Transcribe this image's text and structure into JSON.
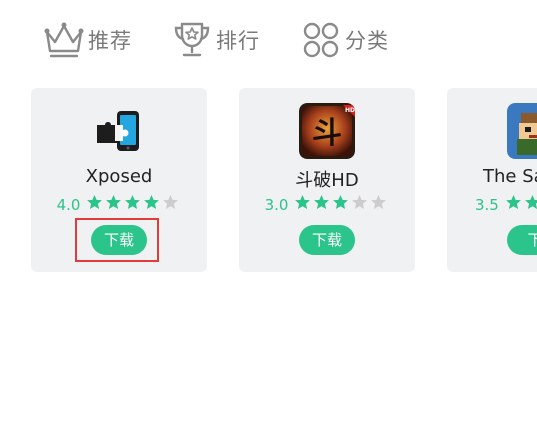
{
  "nav": {
    "items": [
      {
        "label": "推荐",
        "icon": "crown-icon"
      },
      {
        "label": "排行",
        "icon": "trophy-icon"
      },
      {
        "label": "分类",
        "icon": "category-grid-icon"
      }
    ],
    "color": "#7a7a7a"
  },
  "apps": [
    {
      "name": "Xposed",
      "rating": "4.0",
      "rating_value": 4.0,
      "download_label": "下载",
      "icon": "xposed-puzzle-icon"
    },
    {
      "name": "斗破HD",
      "rating": "3.0",
      "rating_value": 3.0,
      "download_label": "下载",
      "icon": "doupo-game-icon"
    },
    {
      "name": "The Sa",
      "rating": "3.5",
      "rating_value": 3.5,
      "download_label": "下",
      "icon": "pixel-game-icon"
    }
  ],
  "colors": {
    "accent": "#2bc48a",
    "card_bg": "#f0f1f3",
    "star_filled": "#2bc48a",
    "star_empty": "#cccccc",
    "highlight": "#e23b3b"
  }
}
